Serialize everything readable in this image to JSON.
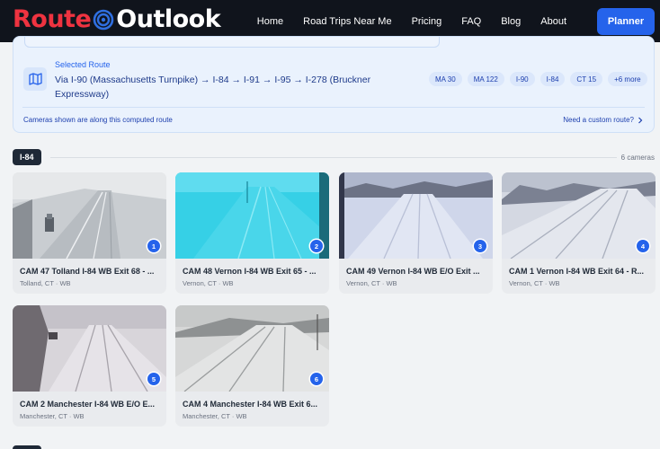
{
  "brand": {
    "part1": "Route",
    "part2": "Outlook",
    "accent": "#ef3340"
  },
  "nav": {
    "links": [
      "Home",
      "Road Trips Near Me",
      "Pricing",
      "FAQ",
      "Blog",
      "About"
    ],
    "cta": "Planner"
  },
  "route": {
    "label": "Selected Route",
    "text": "Via I-90 (Massachusetts Turnpike) → I-84 → I-91 → I-95 → I-278 (Bruckner Expressway)",
    "chips": [
      "MA 30",
      "MA 122",
      "I-90",
      "I-84",
      "CT 15",
      "+6 more"
    ],
    "footer_left": "Cameras shown are along this computed route",
    "footer_right": "Need a custom route?"
  },
  "section": {
    "tag": "I-84",
    "count": "6 cameras"
  },
  "cameras": [
    {
      "n": "1",
      "title": "CAM 47 Tolland I-84 WB Exit 68 - ...",
      "sub": "Tolland, CT · WB"
    },
    {
      "n": "2",
      "title": "CAM 48 Vernon I-84 WB Exit 65 - ...",
      "sub": "Vernon, CT · WB"
    },
    {
      "n": "3",
      "title": "CAM 49 Vernon I-84 WB E/O Exit ...",
      "sub": "Vernon, CT · WB"
    },
    {
      "n": "4",
      "title": "CAM 1 Vernon I-84 WB Exit 64 - R...",
      "sub": "Vernon, CT · WB"
    },
    {
      "n": "5",
      "title": "CAM 2 Manchester I-84 WB E/O E...",
      "sub": "Manchester, CT · WB"
    },
    {
      "n": "6",
      "title": "CAM 4 Manchester I-84 WB Exit 6...",
      "sub": "Manchester, CT · WB"
    }
  ]
}
